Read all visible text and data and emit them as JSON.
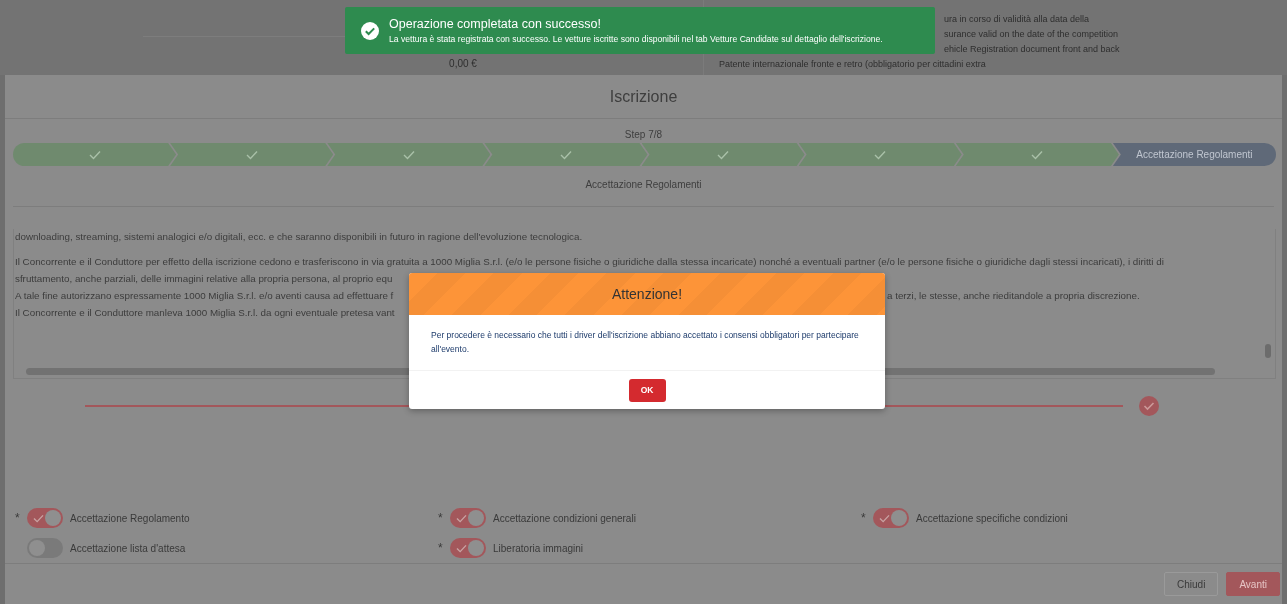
{
  "background_page": {
    "price": "0,00 €",
    "requirements": [
      "ura in corso di validità alla data della",
      "surance valid on the date of the competition",
      "ehicle Registration document front and back"
    ],
    "bullet": "Patente internazionale fronte e retro (obbligatorio per cittadini extra"
  },
  "toast": {
    "title": "Operazione completata con successo!",
    "message": "La vettura è stata registrata con successo. Le vetture iscritte sono disponibili nel tab Vetture Candidate sul dettaglio dell'iscrizione."
  },
  "dialog": {
    "title": "Iscrizione",
    "step_counter": "Step 7/8",
    "steps": [
      {
        "completed": true
      },
      {
        "completed": true
      },
      {
        "completed": true
      },
      {
        "completed": true
      },
      {
        "completed": true
      },
      {
        "completed": true
      },
      {
        "completed": true
      },
      {
        "completed": false,
        "label": "Accettazione Regolamenti"
      }
    ],
    "section_title": "Accettazione Regolamenti",
    "terms_text": {
      "top_line": "downloading, streaming, sistemi analogici e/o digitali, ecc. e che saranno disponibili in futuro in ragione dell'evoluzione tecnologica.",
      "full_line": "Il Concorrente e il Conduttore per effetto della iscrizione cedono e trasferiscono in via gratuita a 1000 Miglia S.r.l. (e/o le persone fisiche o giuridiche dalla stessa incaricate) nonché a eventuali partner (e/o le persone fisiche o giuridiche dagli stessi incaricati), i diritti di",
      "lines": [
        {
          "left": "sfruttamento, anche parziali, delle immagini relative alla propria persona, al proprio equ"
        },
        {
          "left": "A tale fine autorizzano espressamente 1000 Miglia S.r.l. e/o aventi causa ad effettuare f",
          "right": "a terzi, le stesse, anche rieditandole a propria discrezione."
        },
        {
          "left": "Il Concorrente e il Conduttore manleva 1000 Miglia S.r.l. da ogni eventuale pretesa vant"
        }
      ]
    },
    "reading_progress": {
      "level": 1
    },
    "consents": [
      {
        "label": "Accettazione Regolamento",
        "required": true,
        "on": true
      },
      {
        "label": "Accettazione condizioni generali",
        "required": true,
        "on": true
      },
      {
        "label": "Accettazione specifiche condizioni",
        "required": true,
        "on": true
      },
      {
        "label": "Accettazione lista d'attesa",
        "required": false,
        "on": false
      },
      {
        "label": "Liberatoria immagini",
        "required": true,
        "on": true
      }
    ],
    "required_mark": "*",
    "buttons": [
      {
        "label": "Chiudi",
        "kind": "secondary"
      },
      {
        "label": "Avanti",
        "kind": "primary"
      }
    ]
  },
  "alert": {
    "title": "Attenzione!",
    "message": "Per procedere è necessario che tutti i driver dell'iscrizione abbiano accettato i consensi obbligatori per partecipare all'evento.",
    "button": "OK"
  }
}
